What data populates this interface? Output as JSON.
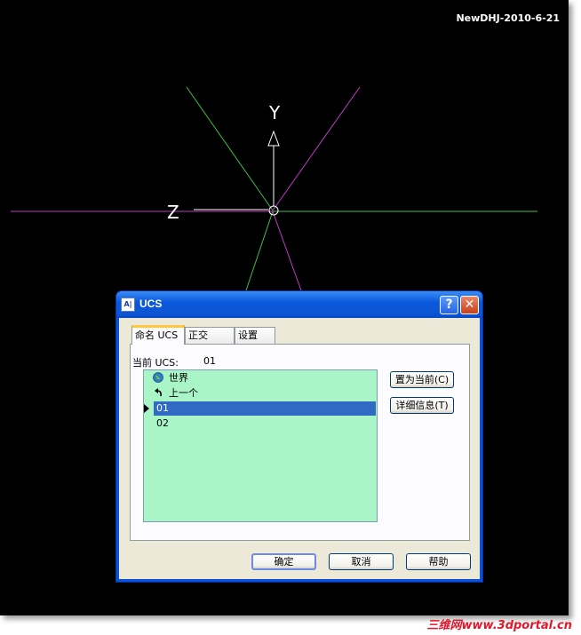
{
  "screen": {
    "watermark_top": "NewDHJ-2010-6-21",
    "footer_watermark": "三维网www.3dportal.cn",
    "axis_labels": {
      "y": "Y",
      "z": "Z"
    }
  },
  "dialog": {
    "title": "UCS",
    "title_buttons": {
      "help": "?",
      "close": "✕"
    },
    "tabs": [
      {
        "label": "命名 UCS",
        "active": true
      },
      {
        "label": "正交 UCS",
        "active": false
      },
      {
        "label": "设置",
        "active": false
      }
    ],
    "current_ucs_label": "当前 UCS:",
    "current_ucs_value": "01",
    "ucs_list": [
      {
        "label": "世界",
        "icon": "globe-icon"
      },
      {
        "label": "上一个",
        "icon": "undo-arrow-icon"
      },
      {
        "label": "01",
        "selected": true,
        "icon": "current-pointer-icon"
      },
      {
        "label": "02"
      }
    ],
    "side_buttons": {
      "set_current": "置为当前(C)",
      "details": "详细信息(T)"
    },
    "footer_buttons": {
      "ok": "确定",
      "cancel": "取消",
      "help": "帮助"
    }
  },
  "colors": {
    "canvas_bg": "#000000",
    "axis_green": "#3fbf3f",
    "axis_magenta": "#c23ac8",
    "list_bg": "#a9f5c8",
    "selection": "#316ac5",
    "titlebar_blue": "#0a59dc"
  }
}
